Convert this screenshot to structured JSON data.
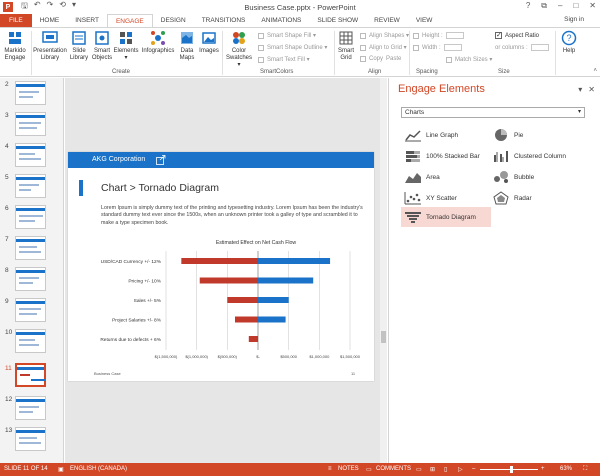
{
  "window": {
    "title": "Business Case.pptx - PowerPoint",
    "app_icon": "P",
    "qat_icons": [
      "save-icon",
      "undo-icon",
      "redo-icon",
      "repeat-icon",
      "customize-icon"
    ],
    "controls": [
      "help-icon",
      "ribbon-display-icon",
      "minimize-icon",
      "restore-icon",
      "close-icon"
    ]
  },
  "tabs": [
    "FILE",
    "HOME",
    "INSERT",
    "ENGAGE",
    "DESIGN",
    "TRANSITIONS",
    "ANIMATIONS",
    "SLIDE SHOW",
    "REVIEW",
    "VIEW"
  ],
  "active_tab": "ENGAGE",
  "sign_in": "Sign in",
  "ribbon": {
    "markido": {
      "l1": "Markido",
      "l2": "Engage"
    },
    "presentation_library": {
      "l1": "Presentation",
      "l2": "Library"
    },
    "slide_library": {
      "l1": "Slide",
      "l2": "Library"
    },
    "smart_objects": {
      "l1": "Smart",
      "l2": "Objects"
    },
    "elements": {
      "l1": "Elements",
      "l2": "▾"
    },
    "infographics": {
      "l1": "Infographics",
      "l2": ""
    },
    "data_maps": {
      "l1": "Data",
      "l2": "Maps"
    },
    "images": {
      "l1": "Images",
      "l2": ""
    },
    "color_swatches": {
      "l1": "Color",
      "l2": "Swatches ▾"
    },
    "smart_shape_fill": "Smart Shape Fill ▾",
    "smart_shape_outline": "Smart Shape Outline ▾",
    "smart_text_fill": "Smart Text Fill ▾",
    "smart_grid": {
      "l1": "Smart",
      "l2": "Grid"
    },
    "align_shapes": "Align Shapes ▾",
    "align_to_grid": "Align to Grid ▾",
    "copy": "Copy",
    "paste": "Paste",
    "height_label": "Height :",
    "width_label": "Width :",
    "aspect_ratio": "Aspect Ratio",
    "or_columns": "or columns :",
    "match_sizes": "Match Sizes ▾",
    "help": "Help",
    "groups": {
      "create": "Create",
      "smartcolors": "SmartColors",
      "align": "Align",
      "spacing": "Spacing",
      "size": "Size"
    }
  },
  "thumbnails": {
    "numbers": [
      "2",
      "3",
      "4",
      "5",
      "6",
      "7",
      "8",
      "9",
      "10",
      "11",
      "12",
      "13"
    ],
    "selected": "11"
  },
  "slide": {
    "company": "AKG Corporation",
    "title": "Chart > Tornado Diagram",
    "body": "Lorem Ipsum is simply dummy text of the printing and typesetting industry. Lorem Ipsum has been the industry's standard dummy text ever since the 1500s, when an unknown printer took a galley of type and scrambled it to make a type specimen book.",
    "footer_left": "Business Case",
    "footer_right": "11"
  },
  "chart_data": {
    "type": "bar",
    "orientation": "horizontal",
    "stacked": "diverging",
    "title": "Estimated Effect on Net Cash Flow",
    "categories": [
      "USD/CAD Currency +/- 12%",
      "Pricing +/- 10%",
      "Sales +/- 5%",
      "Project Salaries +/- 8%",
      "Returns due to defects + 6%"
    ],
    "series": [
      {
        "color": "#c0392b",
        "values": [
          -1250000,
          -950000,
          -500000,
          -375000,
          -150000
        ]
      },
      {
        "color": "#1a73c8",
        "values": [
          1175000,
          900000,
          500000,
          450000,
          0
        ]
      }
    ],
    "xticks": [
      "$(1,500,000)",
      "$(1,000,000)",
      "$(500,000)",
      "$-",
      "$500,000",
      "$1,000,000",
      "$1,500,000"
    ],
    "xlim": [
      -1500000,
      1500000
    ],
    "grid": true
  },
  "pane": {
    "title": "Engage Elements",
    "dropdown": "Charts",
    "items": [
      {
        "label": "Line Graph",
        "icon": "line-graph-icon"
      },
      {
        "label": "Pie",
        "icon": "pie-chart-icon"
      },
      {
        "label": "100% Stacked Bar",
        "icon": "stacked-bar-icon"
      },
      {
        "label": "Clustered Column",
        "icon": "clustered-column-icon"
      },
      {
        "label": "Area",
        "icon": "area-chart-icon"
      },
      {
        "label": "Bubble",
        "icon": "bubble-chart-icon"
      },
      {
        "label": "XY Scatter",
        "icon": "scatter-chart-icon"
      },
      {
        "label": "Radar",
        "icon": "radar-chart-icon"
      },
      {
        "label": "Tornado Diagram",
        "icon": "tornado-diagram-icon"
      }
    ],
    "active_item": "Tornado Diagram"
  },
  "status": {
    "slide_of": "SLIDE 11 OF 14",
    "language": "ENGLISH (CANADA)",
    "notes": "NOTES",
    "comments": "COMMENTS",
    "zoom": "63%"
  },
  "colors": {
    "accent": "#d24726",
    "brand_blue": "#1a73c8",
    "bar_red": "#c0392b"
  }
}
